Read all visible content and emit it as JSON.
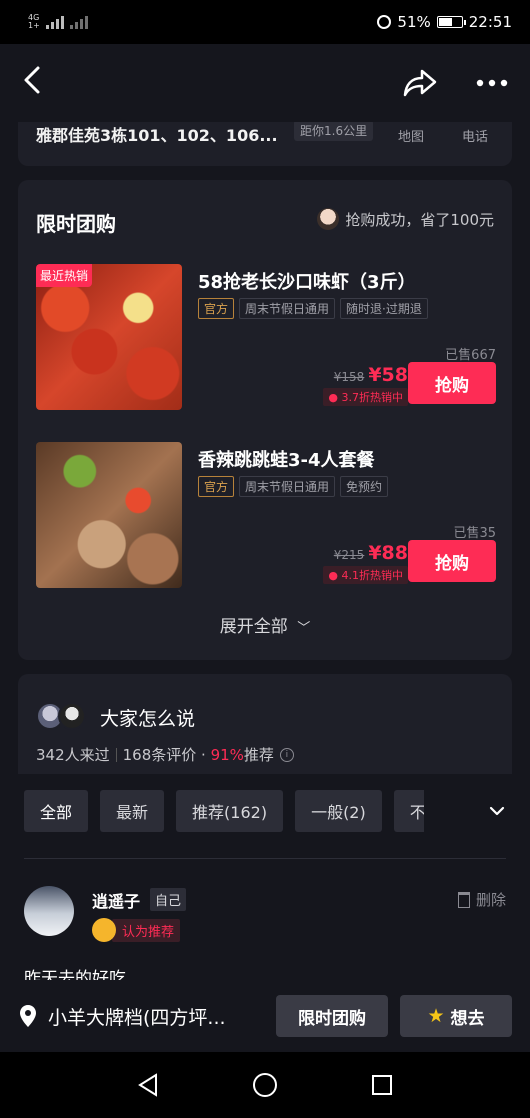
{
  "status_bar": {
    "network": "4G",
    "network_sub": "1+",
    "battery": "51%",
    "time": "22:51"
  },
  "shop_info": {
    "address": "雅郡佳苑3栋101、102、106...",
    "distance": "距你1.6公里",
    "map_label": "地图",
    "phone_label": "电话"
  },
  "group_buy": {
    "title": "限时团购",
    "note": "抢购成功，省了100元",
    "deals": [
      {
        "hot_tag": "最近热销",
        "title": "58抢老长沙口味虾（3斤）",
        "tags": [
          "官方",
          "周末节假日通用",
          "随时退·过期退"
        ],
        "sold": "已售667",
        "original_price": "¥158",
        "price": "¥58",
        "discount": "3.7折热销中",
        "buy_label": "抢购"
      },
      {
        "hot_tag": "",
        "title": "香辣跳跳蛙3-4人套餐",
        "tags": [
          "官方",
          "周末节假日通用",
          "免预约"
        ],
        "sold": "已售35",
        "original_price": "¥215",
        "price": "¥88",
        "discount": "4.1折热销中",
        "buy_label": "抢购"
      }
    ],
    "expand_label": "展开全部"
  },
  "reviews": {
    "title": "大家怎么说",
    "visited": "342人来过",
    "count": "168条评价 · ",
    "recommend_pct": "91%",
    "recommend_label": "推荐",
    "filters": [
      "全部",
      "最新",
      "推荐(162)",
      "一般(2)",
      "不"
    ],
    "item": {
      "user": "逍遥子",
      "self_tag": "自己",
      "delete_label": "删除",
      "recommend_label": "认为推荐",
      "text": "昨天去的好吃"
    }
  },
  "bottom_bar": {
    "shop_name": "小羊大牌档(四方坪...",
    "group_buy_button": "限时团购",
    "want_button": "想去"
  },
  "colors": {
    "background": "#15161d",
    "card": "#1e1f28",
    "accent": "#fe2c55",
    "official_tag": "#d9a14f"
  }
}
